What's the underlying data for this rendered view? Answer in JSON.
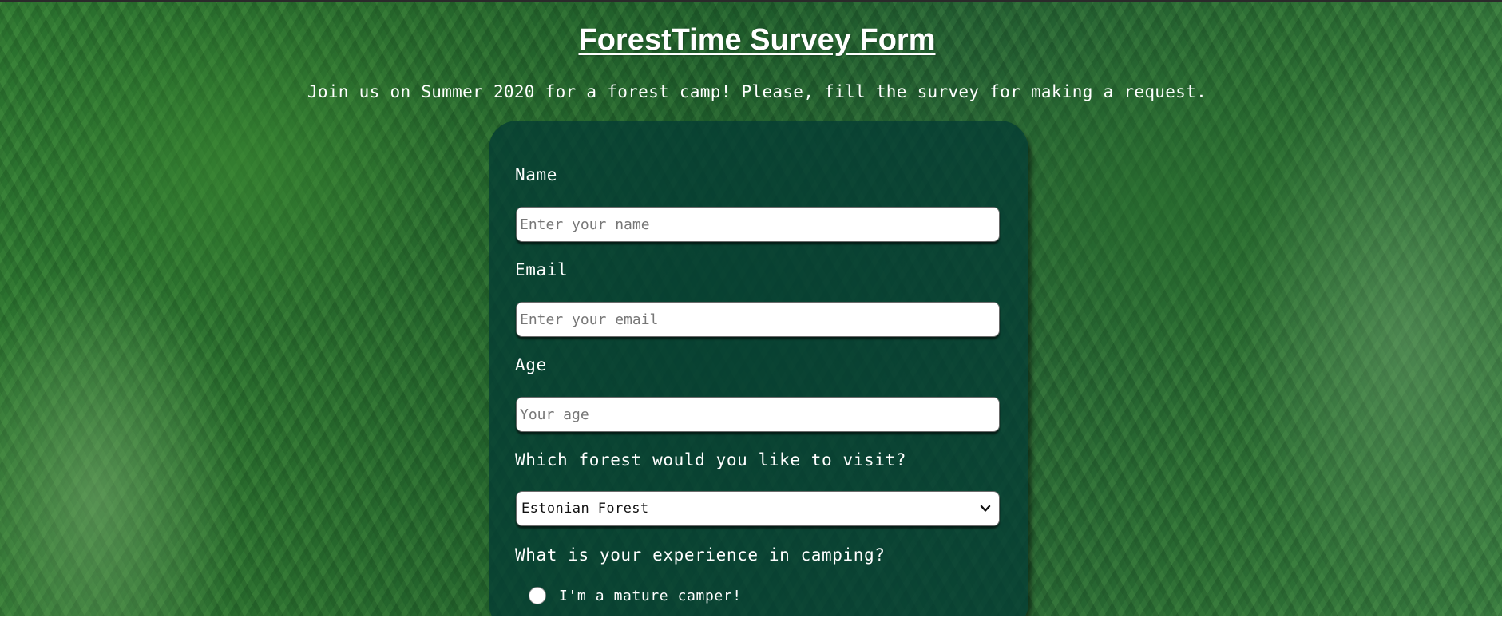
{
  "page": {
    "title": "ForestTime Survey Form",
    "description": "Join us on Summer 2020 for a forest camp! Please, fill the survey for making a request."
  },
  "form": {
    "name": {
      "label": "Name",
      "placeholder": "Enter your name",
      "value": ""
    },
    "email": {
      "label": "Email",
      "placeholder": "Enter your email",
      "value": ""
    },
    "age": {
      "label": "Age",
      "placeholder": "Your age",
      "value": ""
    },
    "forest": {
      "label": "Which forest would you like to visit?",
      "selected": "Estonian Forest"
    },
    "experience": {
      "label": "What is your experience in camping?",
      "options": [
        {
          "label": "I'm a mature camper!",
          "checked": false
        }
      ]
    }
  },
  "icons": {
    "dropdown": "chevron-down-icon",
    "radio": "radio-unchecked"
  },
  "colors": {
    "card_background": "#043c34",
    "text": "#ffffff",
    "field_background": "#ffffff",
    "placeholder": "#777777"
  }
}
